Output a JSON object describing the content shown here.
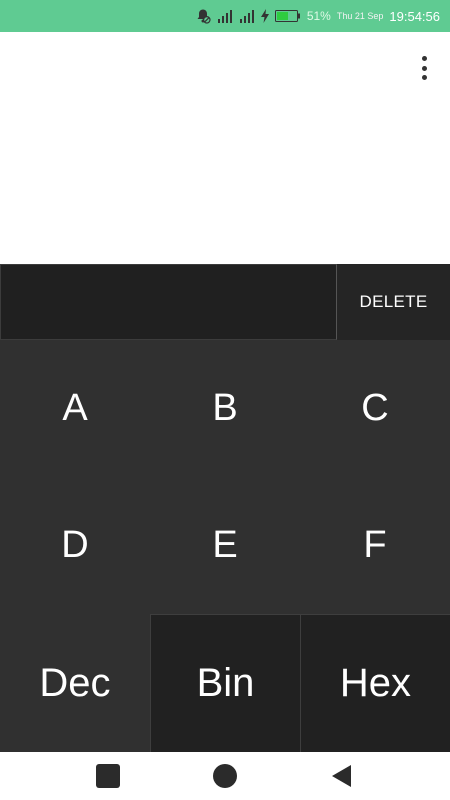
{
  "status_bar": {
    "battery_percent": "51%",
    "date": "Thu 21 Sep",
    "time": "19:54:56",
    "icons": [
      "notifications-muted-icon",
      "signal-icon",
      "signal-icon",
      "charging-icon",
      "battery-icon"
    ]
  },
  "display": {
    "menu_icon": "more-vert-icon"
  },
  "input": {
    "value": "",
    "delete_label": "DELETE"
  },
  "keypad": {
    "rows": [
      [
        "A",
        "B",
        "C"
      ],
      [
        "D",
        "E",
        "F"
      ]
    ]
  },
  "bases": {
    "dec_label": "Dec",
    "bin_label": "Bin",
    "hex_label": "Hex",
    "selected": "Dec"
  },
  "nav_bar": {
    "icons": [
      "recents-square-icon",
      "home-circle-icon",
      "back-triangle-icon"
    ]
  },
  "colors": {
    "status_bar": "#5fcb92",
    "keypad_bg": "#303030",
    "dark_key_bg": "#212121",
    "text": "#ffffff"
  }
}
